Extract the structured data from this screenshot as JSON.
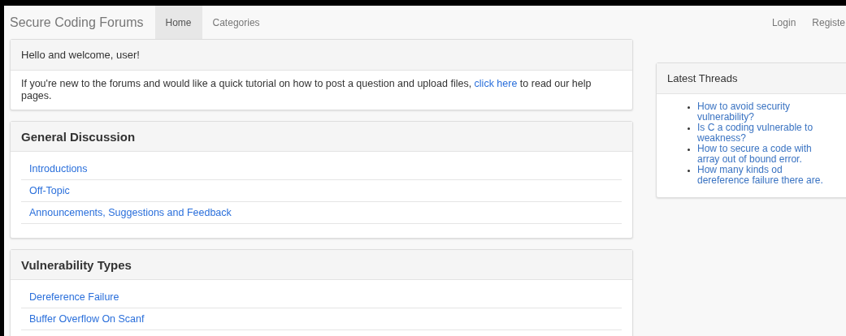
{
  "navbar": {
    "brand": "Secure Coding Forums",
    "tabs": [
      {
        "label": "Home",
        "selected": true
      },
      {
        "label": "Categories",
        "selected": false
      }
    ],
    "right_links": [
      "Login",
      "Registe"
    ]
  },
  "welcome": {
    "title": "Hello and welcome, user!",
    "text_before": "If you're new to the forums and would like a quick tutorial on how to post a question and upload files,",
    "link": "click here",
    "text_after": "to read our help pages."
  },
  "sections": [
    {
      "title": "General Discussion",
      "forums": [
        "Introductions",
        "Off-Topic",
        "Announcements, Suggestions and Feedback"
      ]
    },
    {
      "title": "Vulnerability Types",
      "forums": [
        "Dereference Failure",
        "Buffer Overflow On Scanf"
      ]
    }
  ],
  "latest_threads": {
    "title": "Latest Threads",
    "threads": [
      "How to avoid security vulnerability?",
      "Is C a coding vulnerable to weakness?",
      "How to secure a code with array out of bound error.",
      "How many kinds od dereference failure there are."
    ]
  }
}
